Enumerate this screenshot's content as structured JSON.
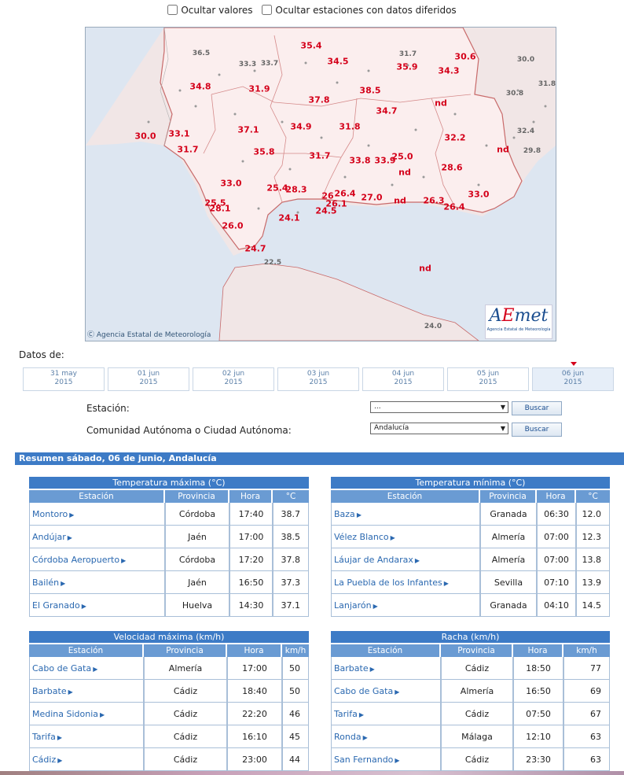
{
  "options": {
    "hide_values": "Ocultar valores",
    "hide_deferred": "Ocultar estaciones con datos diferidos"
  },
  "map": {
    "copyright": "Agencia Estatal de Meteorología",
    "logo_text": "AEmet",
    "logo_sub": "Agencia Estatal de Meteorología",
    "values_red": [
      "35.4",
      "34.5",
      "35.9",
      "30.6",
      "34.3",
      "34.8",
      "31.9",
      "37.8",
      "38.5",
      "34.7",
      "nd",
      "37.1",
      "34.9",
      "31.8",
      "30.0",
      "33.1",
      "31.7",
      "35.8",
      "31.7",
      "32.2",
      "nd",
      "25.0",
      "33.8",
      "33.9",
      "nd",
      "28.6",
      "33.0",
      "25.4",
      "28.3",
      "26.4",
      "26.1",
      "27.0",
      "nd",
      "26.3",
      "26.4",
      "33.0",
      "25.5",
      "28.1",
      "24.1",
      "24.5",
      "26.0",
      "24.7",
      "nd",
      "26"
    ],
    "values_gray": [
      "36.5",
      "33.3",
      "33.7",
      "31.7",
      "30.0",
      "31.8",
      "30.8",
      "32.4",
      "29.8",
      "22.5",
      "24.0"
    ]
  },
  "dates_label": "Datos de:",
  "dates": [
    {
      "day": "31 may",
      "year": "2015"
    },
    {
      "day": "01 jun",
      "year": "2015"
    },
    {
      "day": "02 jun",
      "year": "2015"
    },
    {
      "day": "03 jun",
      "year": "2015"
    },
    {
      "day": "04 jun",
      "year": "2015"
    },
    {
      "day": "05 jun",
      "year": "2015"
    },
    {
      "day": "06 jun",
      "year": "2015"
    }
  ],
  "form": {
    "station_label": "Estación:",
    "station_value": "...",
    "ccaa_label": "Comunidad Autónoma o Ciudad Autónoma:",
    "ccaa_value": "Andalucía",
    "search": "Buscar"
  },
  "summary_title": "Resumen sábado, 06 de junio, Andalucía",
  "tables": {
    "tmax": {
      "title": "Temperatura máxima (°C)",
      "headers": [
        "Estación",
        "Provincia",
        "Hora",
        "°C"
      ],
      "rows": [
        [
          "Montoro",
          "Córdoba",
          "17:40",
          "38.7"
        ],
        [
          "Andújar",
          "Jaén",
          "17:00",
          "38.5"
        ],
        [
          "Córdoba Aeropuerto",
          "Córdoba",
          "17:20",
          "37.8"
        ],
        [
          "Bailén",
          "Jaén",
          "16:50",
          "37.3"
        ],
        [
          "El Granado",
          "Huelva",
          "14:30",
          "37.1"
        ]
      ]
    },
    "tmin": {
      "title": "Temperatura mínima (°C)",
      "headers": [
        "Estación",
        "Provincia",
        "Hora",
        "°C"
      ],
      "rows": [
        [
          "Baza",
          "Granada",
          "06:30",
          "12.0"
        ],
        [
          "Vélez Blanco",
          "Almería",
          "07:00",
          "12.3"
        ],
        [
          "Láujar de Andarax",
          "Almería",
          "07:00",
          "13.8"
        ],
        [
          "La Puebla de los Infantes",
          "Sevilla",
          "07:10",
          "13.9"
        ],
        [
          "Lanjarón",
          "Granada",
          "04:10",
          "14.5"
        ]
      ]
    },
    "wind": {
      "title": "Velocidad máxima (km/h)",
      "headers": [
        "Estación",
        "Provincia",
        "Hora",
        "km/h"
      ],
      "rows": [
        [
          "Cabo de Gata",
          "Almería",
          "17:00",
          "50"
        ],
        [
          "Barbate",
          "Cádiz",
          "18:40",
          "50"
        ],
        [
          "Medina Sidonia",
          "Cádiz",
          "22:20",
          "46"
        ],
        [
          "Tarifa",
          "Cádiz",
          "16:10",
          "45"
        ],
        [
          "Cádiz",
          "Cádiz",
          "23:00",
          "44"
        ]
      ]
    },
    "gust": {
      "title": "Racha (km/h)",
      "headers": [
        "Estación",
        "Provincia",
        "Hora",
        "km/h"
      ],
      "rows": [
        [
          "Barbate",
          "Cádiz",
          "18:50",
          "77"
        ],
        [
          "Cabo de Gata",
          "Almería",
          "16:50",
          "69"
        ],
        [
          "Tarifa",
          "Cádiz",
          "07:50",
          "67"
        ],
        [
          "Ronda",
          "Málaga",
          "12:10",
          "63"
        ],
        [
          "San Fernando",
          "Cádiz",
          "23:30",
          "63"
        ]
      ]
    }
  }
}
